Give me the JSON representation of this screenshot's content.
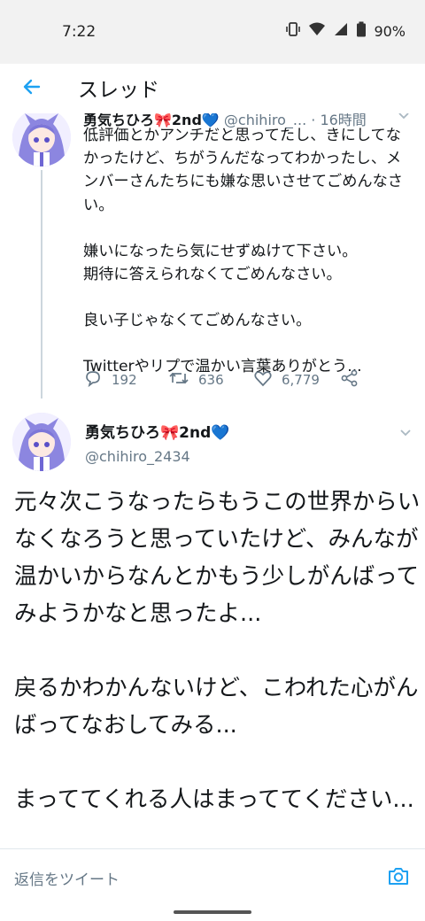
{
  "status_bar": {
    "time": "7:22",
    "battery": "90%",
    "icons": [
      "vibrate-icon",
      "wifi-icon",
      "signal-icon",
      "battery-icon"
    ]
  },
  "header": {
    "back_icon": "arrow-left-icon",
    "title": "スレッド"
  },
  "tweets": [
    {
      "name": "勇気ちひろ🎀2nd💙",
      "handle_short": "@chihiro_...",
      "time": "· 16時間",
      "body": [
        "低評価とかアンチだと思ってたし、きにしてなかったけど、ちがうんだなってわかったし、メンバーさんたちにも嫌な思いさせてごめんなさい。",
        "嫌いになったら気にせずぬけて下さい。\n期待に答えられなくてごめんなさい。",
        "良い子じゃなくてごめんなさい。",
        "Twitterやリプで温かい言葉ありがとう..."
      ],
      "replies": "192",
      "retweets": "636",
      "likes": "6,779"
    },
    {
      "name": "勇気ちひろ🎀2nd💙",
      "handle": "@chihiro_2434",
      "body": [
        "元々次こうなったらもうこの世界からいなくなろうと思っていたけど、みんなが温かいからなんとかもう少しがんばってみようかなと思ったよ...",
        "戻るかわかんないけど、こわれた心がんばってなおしてみる...",
        "まっててくれる人はまっててください..."
      ]
    }
  ],
  "reply_bar": {
    "placeholder": "返信をツイート",
    "camera_icon": "camera-icon"
  },
  "colors": {
    "accent": "#1da1f2",
    "text": "#14171a",
    "secondary": "#657786",
    "divider": "#e1e8ed"
  }
}
